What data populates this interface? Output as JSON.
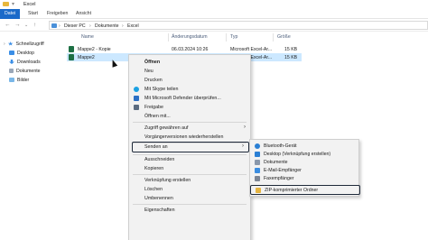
{
  "window": {
    "title": "Excel"
  },
  "ribbon": {
    "tabs": [
      "Datei",
      "Start",
      "Freigeben",
      "Ansicht"
    ]
  },
  "address": {
    "crumbs": [
      "Dieser PC",
      "Dokumente",
      "Excel"
    ]
  },
  "navpane": {
    "items": [
      {
        "label": "Schnellzugriff",
        "icon": "star-icon",
        "color": "#3a8ee6"
      },
      {
        "label": "Desktop",
        "icon": "desktop-icon",
        "color": "#3a8ee6"
      },
      {
        "label": "Downloads",
        "icon": "download-icon",
        "color": "#3a8ee6"
      },
      {
        "label": "Dokumente",
        "icon": "document-icon",
        "color": "#9aa7b8"
      },
      {
        "label": "Bilder",
        "icon": "picture-icon",
        "color": "#7ab7e8"
      }
    ]
  },
  "list": {
    "headers": [
      "Name",
      "Änderungsdatum",
      "Typ",
      "Größe"
    ],
    "rows": [
      {
        "name": "Mappe2 - Kopie",
        "date": "06.03.2024 10:26",
        "type": "Microsoft Excel-Ar...",
        "size": "15 KB",
        "selected": false
      },
      {
        "name": "Mappe2",
        "date": "",
        "type": "Microsoft Excel-Ar...",
        "size": "15 KB",
        "selected": true
      }
    ]
  },
  "context_menu": {
    "items": [
      "Öffnen",
      "Neu",
      "Drucken",
      "Mit Skype teilen",
      "Mit Microsoft Defender überprüfen...",
      "Freigabe",
      "Öffnen mit...",
      "Zugriff gewähren auf",
      "Vorgängerversionen wiederherstellen",
      "Senden an",
      "Ausschneiden",
      "Kopieren",
      "Verknüpfung erstellen",
      "Löschen",
      "Umbenennen",
      "Eigenschaften"
    ]
  },
  "submenu": {
    "items": [
      "Bluetooth-Gerät",
      "Desktop (Verknüpfung erstellen)",
      "Dokumente",
      "E-Mail-Empfänger",
      "Faxempfänger",
      "ZIP-komprimierter Ordner"
    ]
  },
  "colors": {
    "selection": "#cce8ff",
    "file_tab": "#1b6ac9",
    "excel_green": "#1d7044",
    "highlight_border": "#1f2a3a"
  }
}
